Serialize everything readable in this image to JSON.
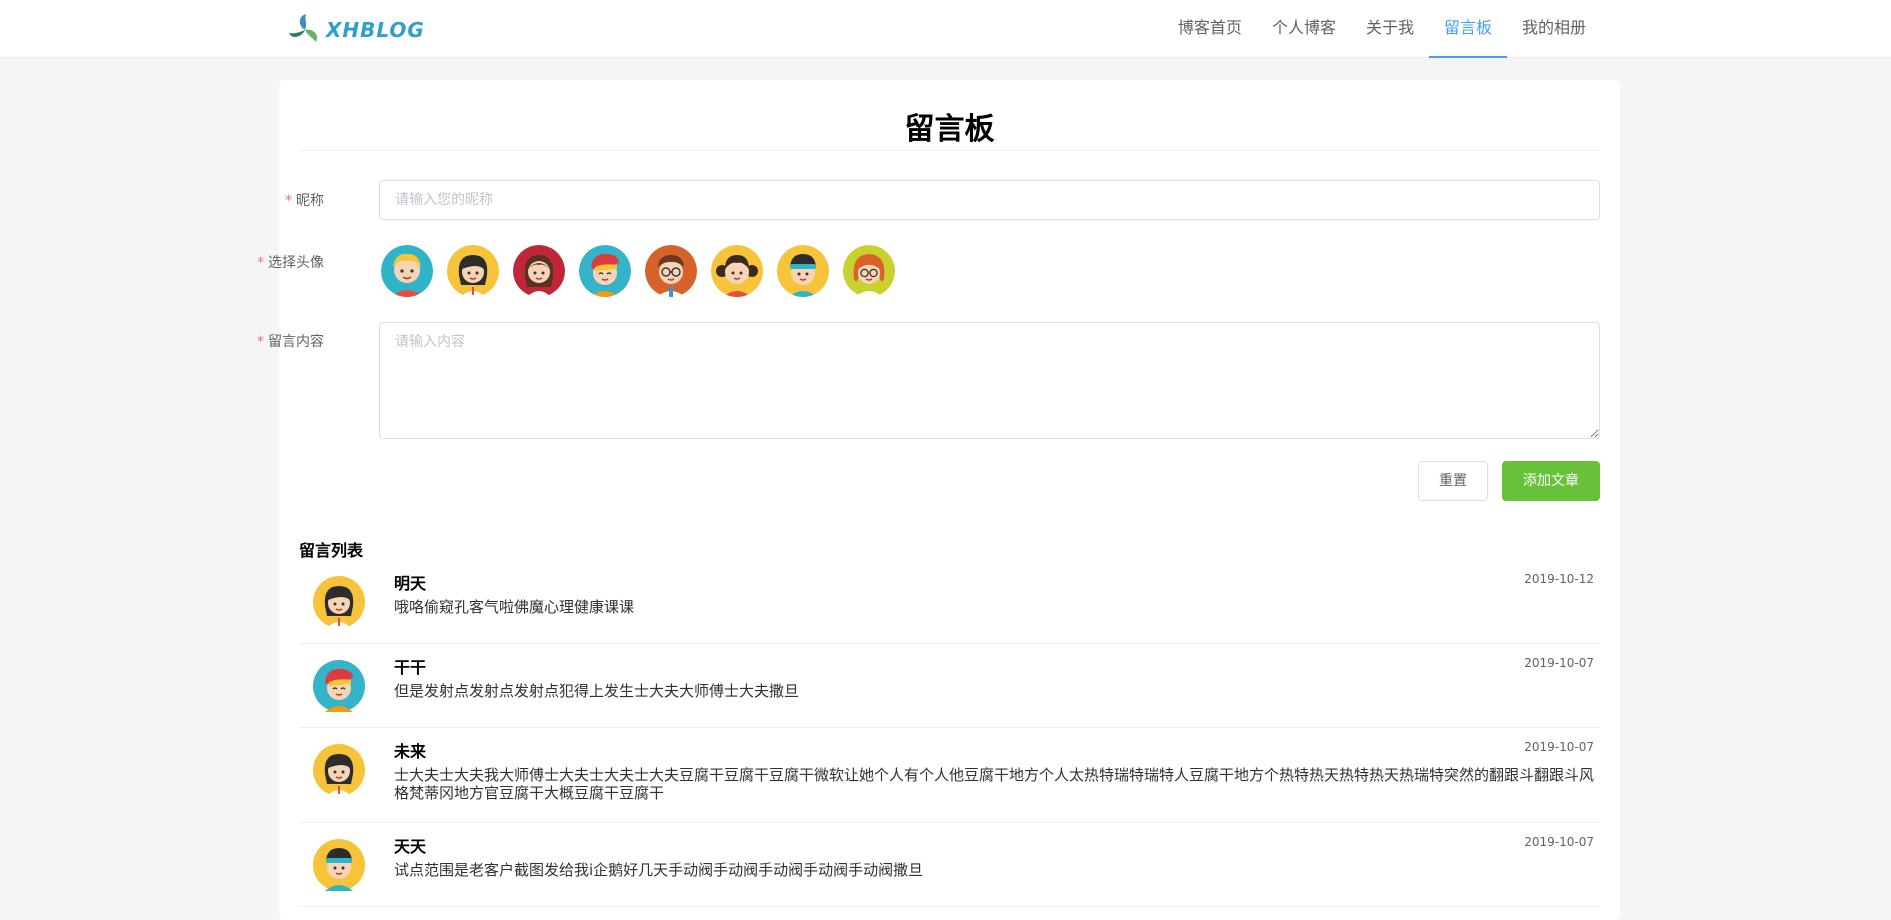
{
  "header": {
    "logo_text": "XHBLOG",
    "nav": [
      {
        "label": "博客首页",
        "active": false
      },
      {
        "label": "个人博客",
        "active": false
      },
      {
        "label": "关于我",
        "active": false
      },
      {
        "label": "留言板",
        "active": true
      },
      {
        "label": "我的相册",
        "active": false
      }
    ],
    "accent_color": "#409eff"
  },
  "page": {
    "title": "留言板"
  },
  "form": {
    "required_mark": "*",
    "nickname_label": "昵称",
    "nickname_placeholder": "请输入您的昵称",
    "nickname_value": "",
    "avatar_label": "选择头像",
    "avatars": [
      "blond-boy-avatar",
      "black-hair-girl-avatar",
      "brown-hair-girl-avatar",
      "red-hat-boy-avatar",
      "glasses-man-avatar",
      "pigtail-girl-avatar",
      "headband-boy-avatar",
      "redhead-glasses-woman-avatar"
    ],
    "content_label": "留言内容",
    "content_placeholder": "请输入内容",
    "content_value": "",
    "reset_button": "重置",
    "submit_button": "添加文章",
    "submit_color": "#67c23a"
  },
  "list": {
    "title": "留言列表",
    "messages": [
      {
        "avatar": "black-hair-girl-avatar",
        "name": "明天",
        "date": "2019-10-12",
        "content": "哦咯偷窥孔客气啦佛魔心理健康课课"
      },
      {
        "avatar": "red-hat-boy-avatar",
        "name": "干干",
        "date": "2019-10-07",
        "content": "但是发射点发射点发射点犯得上发生士大夫大师傅士大夫撒旦"
      },
      {
        "avatar": "black-hair-girl-avatar",
        "name": "未来",
        "date": "2019-10-07",
        "content": "士大夫士大夫我大师傅士大夫士大夫士大夫豆腐干豆腐干豆腐干微软让她个人有个人他豆腐干地方个人太热特瑞特瑞特人豆腐干地方个热特热天热特热天热瑞特突然的翻跟斗翻跟斗风格梵蒂冈地方官豆腐干大概豆腐干豆腐干"
      },
      {
        "avatar": "headband-boy-avatar",
        "name": "天天",
        "date": "2019-10-07",
        "content": "试点范围是老客户截图发给我i企鹅好几天手动阀手动阀手动阀手动阀手动阀撒旦"
      }
    ]
  }
}
